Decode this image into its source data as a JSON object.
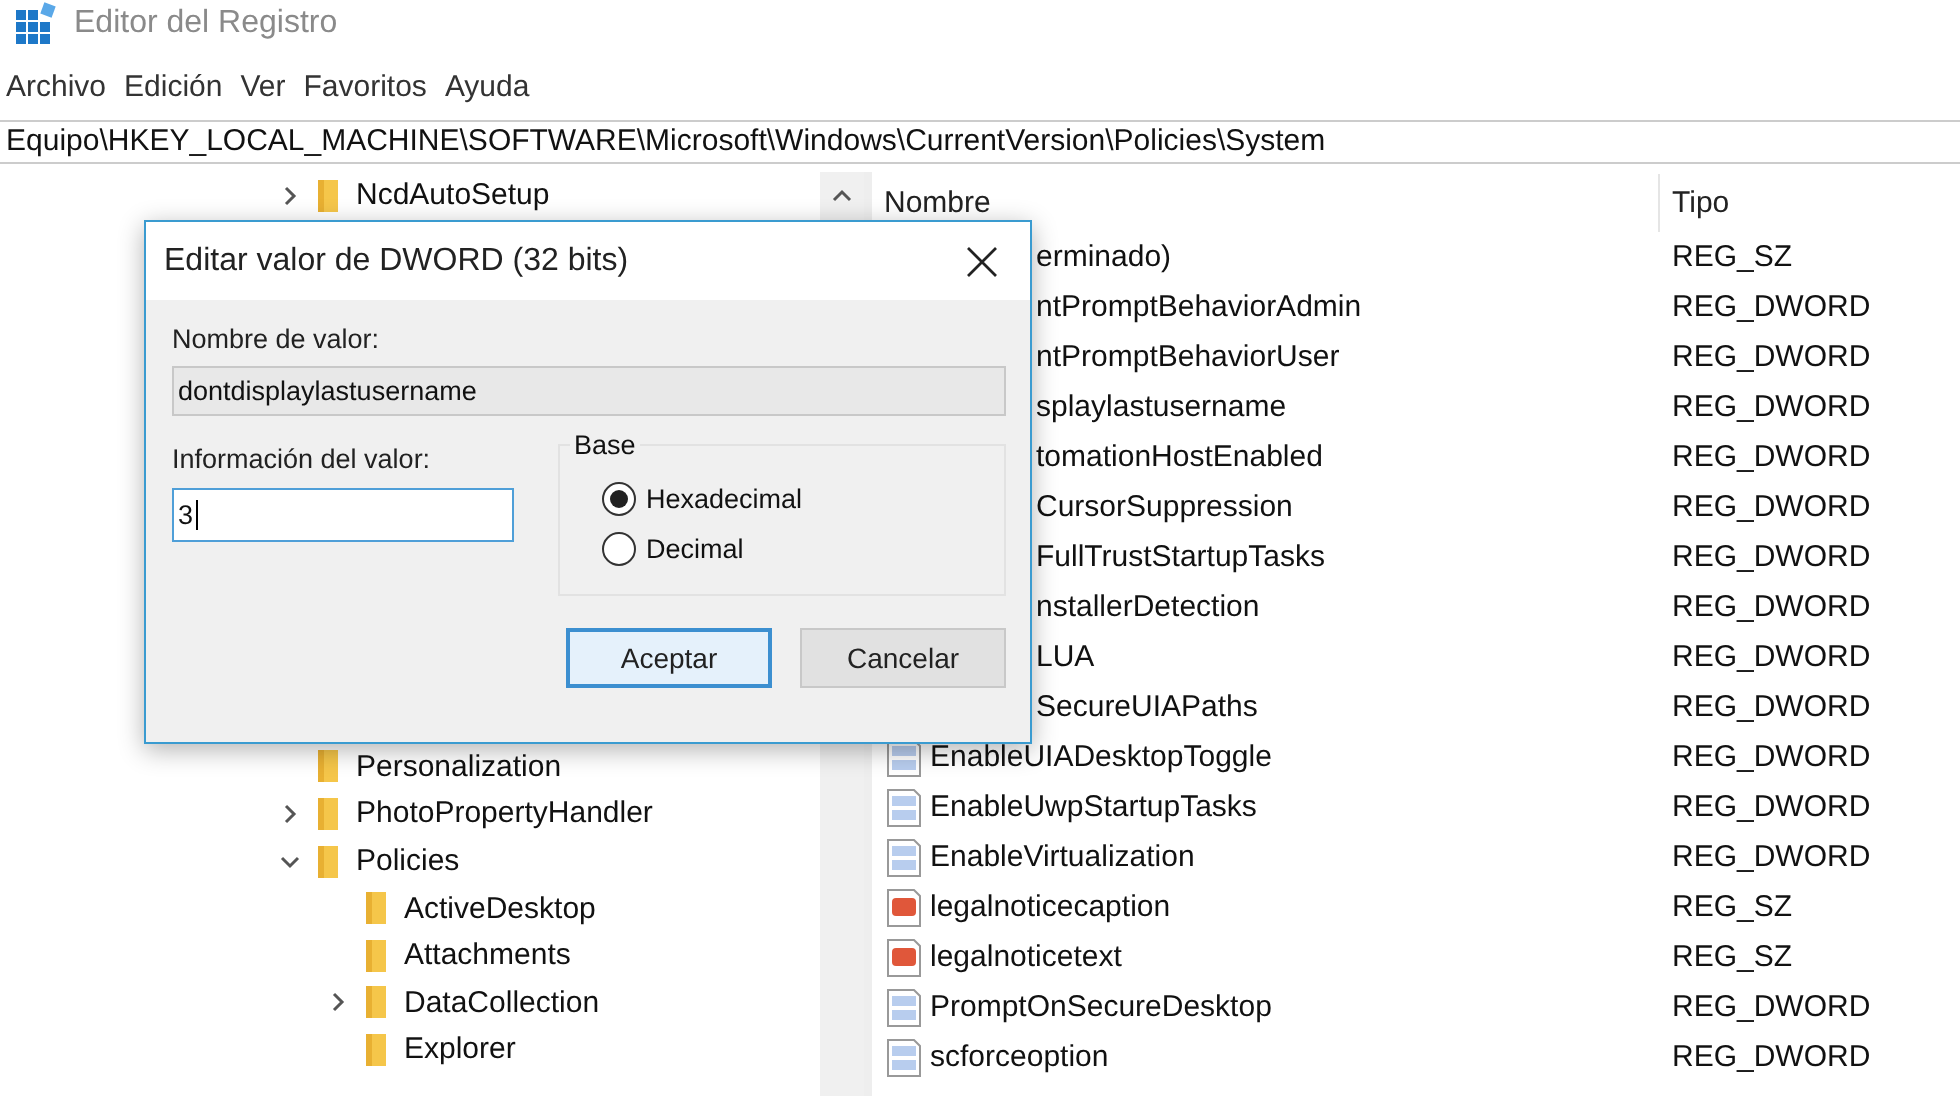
{
  "window": {
    "title": "Editor del Registro"
  },
  "menu": [
    "Archivo",
    "Edición",
    "Ver",
    "Favoritos",
    "Ayuda"
  ],
  "address": "Equipo\\HKEY_LOCAL_MACHINE\\SOFTWARE\\Microsoft\\Windows\\CurrentVersion\\Policies\\System",
  "tree": {
    "top": [
      {
        "label": "NcdAutoSetup",
        "expanded": false
      }
    ],
    "items": [
      {
        "label": "Personalization"
      },
      {
        "label": "PhotoPropertyHandler",
        "expanded": false
      },
      {
        "label": "Policies",
        "expanded": true,
        "children": [
          {
            "label": "ActiveDesktop"
          },
          {
            "label": "Attachments"
          },
          {
            "label": "DataCollection",
            "expanded": false
          },
          {
            "label": "Explorer"
          }
        ]
      }
    ]
  },
  "table": {
    "columns": [
      "Nombre",
      "Tipo"
    ],
    "rows": [
      {
        "name": "erminado)",
        "type": "REG_SZ"
      },
      {
        "name": "ntPromptBehaviorAdmin",
        "type": "REG_DWORD"
      },
      {
        "name": "ntPromptBehaviorUser",
        "type": "REG_DWORD"
      },
      {
        "name": "splaylastusername",
        "type": "REG_DWORD"
      },
      {
        "name": "tomationHostEnabled",
        "type": "REG_DWORD"
      },
      {
        "name": "CursorSuppression",
        "type": "REG_DWORD"
      },
      {
        "name": "FullTrustStartupTasks",
        "type": "REG_DWORD"
      },
      {
        "name": "nstallerDetection",
        "type": "REG_DWORD"
      },
      {
        "name": "LUA",
        "type": "REG_DWORD"
      },
      {
        "name": "SecureUIAPaths",
        "type": "REG_DWORD"
      },
      {
        "name": "EnableUIADesktopToggle",
        "type": "REG_DWORD",
        "kind": "binary"
      },
      {
        "name": "EnableUwpStartupTasks",
        "type": "REG_DWORD",
        "kind": "binary"
      },
      {
        "name": "EnableVirtualization",
        "type": "REG_DWORD",
        "kind": "binary"
      },
      {
        "name": "legalnoticecaption",
        "type": "REG_SZ",
        "kind": "string"
      },
      {
        "name": "legalnoticetext",
        "type": "REG_SZ",
        "kind": "string"
      },
      {
        "name": "PromptOnSecureDesktop",
        "type": "REG_DWORD",
        "kind": "binary"
      },
      {
        "name": "scforceoption",
        "type": "REG_DWORD",
        "kind": "binary"
      }
    ]
  },
  "dialog": {
    "title": "Editar valor de DWORD (32 bits)",
    "name_label": "Nombre de valor:",
    "name_value": "dontdisplaylastusername",
    "data_label": "Información del valor:",
    "data_value": "3",
    "base_label": "Base",
    "radios": [
      {
        "label": "Hexadecimal",
        "selected": true
      },
      {
        "label": "Decimal",
        "selected": false
      }
    ],
    "buttons": [
      {
        "label": "Aceptar",
        "default": true
      },
      {
        "label": "Cancelar",
        "default": false
      }
    ]
  }
}
